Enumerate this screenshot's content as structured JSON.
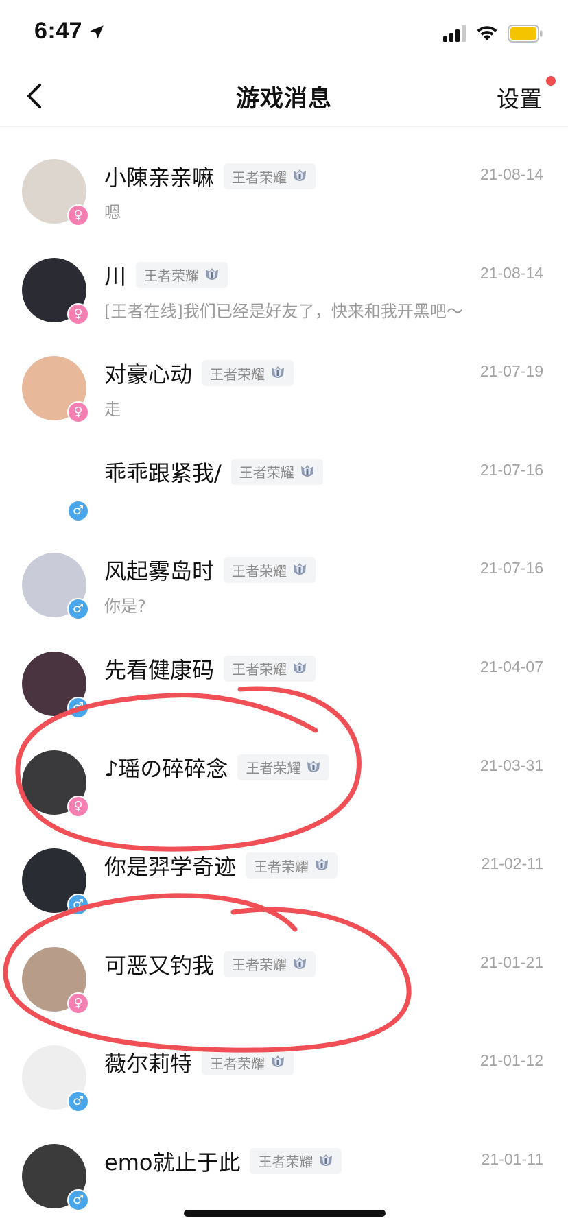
{
  "status_bar": {
    "time": "6:47",
    "battery_color": "#f5c400"
  },
  "nav": {
    "title": "游戏消息",
    "settings_label": "设置",
    "accent_dot_color": "#f04e4e"
  },
  "messages": [
    {
      "name": "小陳亲亲嘛",
      "tag": "王者荣耀",
      "rank_icon": "rank-badge-icon",
      "date": "21-08-14",
      "preview": "嗯",
      "gender": "♀",
      "gender_type": "female",
      "avatar_color": "#dcd6cf"
    },
    {
      "name": "川",
      "tag": "王者荣耀",
      "rank_icon": "rank-badge-icon",
      "date": "21-08-14",
      "preview": "[王者在线]我们已经是好友了，快来和我开黑吧～",
      "gender": "♀",
      "gender_type": "female",
      "avatar_color": "#2b2b33"
    },
    {
      "name": "对豪心动",
      "tag": "王者荣耀",
      "rank_icon": "rank-badge-icon",
      "date": "21-07-19",
      "preview": "走",
      "gender": "♀",
      "gender_type": "female",
      "avatar_color": "#e8b89a"
    },
    {
      "name": "乖乖跟紧我/",
      "tag": "王者荣耀",
      "rank_icon": "rank-badge-icon",
      "date": "21-07-16",
      "preview": "",
      "gender": "♂",
      "gender_type": "male",
      "avatar_color": "#ffffff"
    },
    {
      "name": "风起雾岛时",
      "tag": "王者荣耀",
      "rank_icon": "rank-badge-icon",
      "date": "21-07-16",
      "preview": "你是?",
      "gender": "♂",
      "gender_type": "male",
      "avatar_color": "#c9ccd8"
    },
    {
      "name": "先看健康码",
      "tag": "王者荣耀",
      "rank_icon": "rank-badge-icon",
      "date": "21-04-07",
      "preview": "",
      "gender": "♂",
      "gender_type": "male",
      "avatar_color": "#4a3440"
    },
    {
      "name": "♪瑶の碎碎念",
      "tag": "王者荣耀",
      "rank_icon": "rank-badge-icon",
      "date": "21-03-31",
      "preview": "",
      "gender": "♀",
      "gender_type": "female",
      "avatar_color": "#3a3a3c"
    },
    {
      "name": "你是羿学奇迹",
      "tag": "王者荣耀",
      "rank_icon": "rank-badge-icon",
      "date": "21-02-11",
      "preview": "",
      "gender": "♂",
      "gender_type": "male",
      "avatar_color": "#2a2c34"
    },
    {
      "name": "可恶又钓我",
      "tag": "王者荣耀",
      "rank_icon": "rank-badge-icon",
      "date": "21-01-21",
      "preview": "",
      "gender": "♀",
      "gender_type": "female",
      "avatar_color": "#b89c8a"
    },
    {
      "name": "薇尔莉特",
      "tag": "王者荣耀",
      "rank_icon": "rank-badge-icon",
      "date": "21-01-12",
      "preview": "",
      "gender": "♂",
      "gender_type": "male",
      "avatar_color": "#eeeeee"
    },
    {
      "name": "emo就止于此",
      "tag": "王者荣耀",
      "rank_icon": "rank-badge-icon",
      "date": "21-01-11",
      "preview": "",
      "gender": "♂",
      "gender_type": "male",
      "avatar_color": "#3b3b3b"
    }
  ],
  "annotation_color": "#ef4f55"
}
